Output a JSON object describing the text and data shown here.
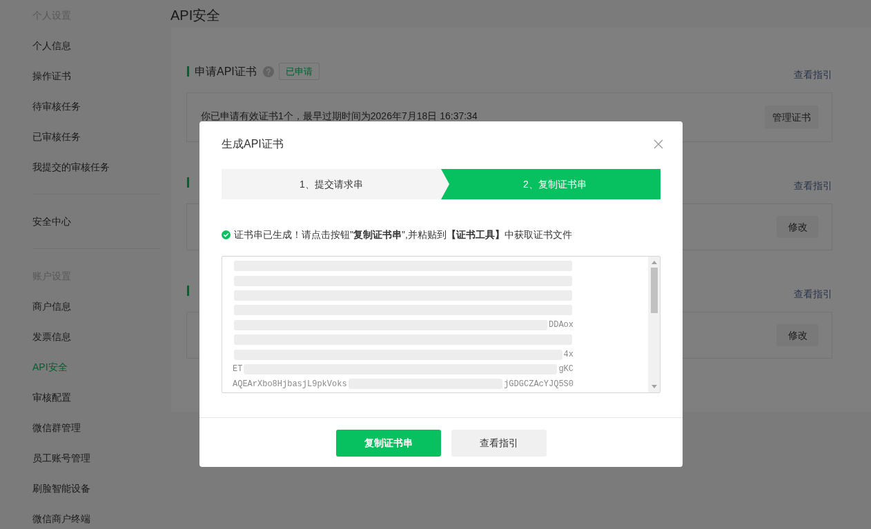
{
  "page_title": "API安全",
  "sidebar": {
    "groups": [
      {
        "heading": "个人设置",
        "items": [
          {
            "label": "个人信息",
            "selected": false
          },
          {
            "label": "操作证书",
            "selected": false
          },
          {
            "label": "待审核任务",
            "selected": false
          },
          {
            "label": "已审核任务",
            "selected": false
          },
          {
            "label": "我提交的审核任务",
            "selected": false
          }
        ]
      },
      {
        "items": [
          {
            "label": "安全中心",
            "selected": false
          }
        ]
      },
      {
        "heading": "账户设置",
        "items": [
          {
            "label": "商户信息",
            "selected": false
          },
          {
            "label": "发票信息",
            "selected": false
          },
          {
            "label": "API安全",
            "selected": true
          },
          {
            "label": "审核配置",
            "selected": false
          },
          {
            "label": "微信群管理",
            "selected": false
          },
          {
            "label": "员工账号管理",
            "selected": false
          },
          {
            "label": "刷脸智能设备",
            "selected": false
          },
          {
            "label": "微信商户终端",
            "selected": false
          }
        ]
      }
    ]
  },
  "sections": [
    {
      "kind": "status",
      "title": "申请API证书",
      "badge": "已申请",
      "link": "查看指引",
      "text": "你已申请有效证书1个，最早过期时间为2026年7月18日 16:37:34",
      "button": "管理证书"
    },
    {
      "kind": "setting",
      "link": "查看指引",
      "button": "修改"
    },
    {
      "kind": "setting",
      "link": "查看指引",
      "button": "修改"
    }
  ],
  "modal": {
    "title": "生成API证书",
    "steps": [
      {
        "label": "1、提交请求串",
        "selected": false
      },
      {
        "label": "2、复制证书串",
        "selected": true
      }
    ],
    "message": "证书串已生成！请点击按钮\"**复制证书串**\",并粘贴到**【证书工具】**中获取证书文件",
    "certificate_lines": [
      {
        "redacted": true
      },
      {
        "redacted": true
      },
      {
        "redacted": true
      },
      {
        "redacted": true
      },
      {
        "redacted": true,
        "end": "DDAox"
      },
      {
        "redacted": true
      },
      {
        "redacted": true,
        "end": "4x"
      },
      {
        "start": "ET",
        "redacted": true,
        "end": "gKC"
      },
      {
        "start": "AQEArXbo8HjbasjL9pkVoks",
        "redacted": true,
        "end": "jGDGCZAcYJQ5S0"
      }
    ],
    "buttons": [
      {
        "label": "复制证书串",
        "kind": "primary"
      },
      {
        "label": "查看指引",
        "kind": "secondary"
      }
    ]
  }
}
